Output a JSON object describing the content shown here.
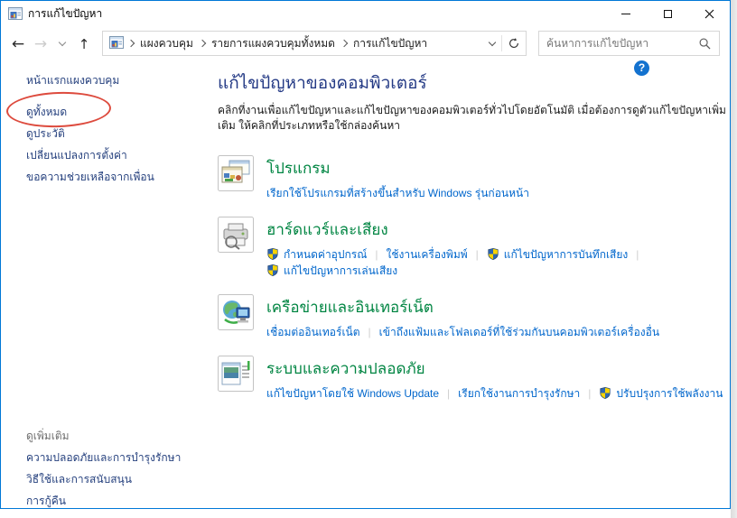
{
  "window": {
    "title": "การแก้ไขปัญหา"
  },
  "toolbar": {
    "breadcrumb": [
      "แผงควบคุม",
      "รายการแผงควบคุมทั้งหมด",
      "การแก้ไขปัญหา"
    ],
    "search_placeholder": "ค้นหาการแก้ไขปัญหา"
  },
  "help": {
    "glyph": "?"
  },
  "sidebar": {
    "items": [
      "หน้าแรกแผงควบคุม",
      "ดูทั้งหมด",
      "ดูประวัติ",
      "เปลี่ยนแปลงการตั้งค่า",
      "ขอความช่วยเหลือจากเพื่อน"
    ],
    "circled_item": "ดูทั้งหมด",
    "see_also_header": "ดูเพิ่มเติม",
    "see_also_items": [
      "ความปลอดภัยและการบำรุงรักษา",
      "วิธีใช้และการสนับสนุน",
      "การกู้คืน"
    ]
  },
  "main": {
    "heading": "แก้ไขปัญหาของคอมพิวเตอร์",
    "description": "คลิกที่งานเพื่อแก้ไขปัญหาและแก้ไขปัญหาของคอมพิวเตอร์ทั่วไปโดยอัตโนมัติ เมื่อต้องการดูตัวแก้ไขปัญหาเพิ่มเติม ให้คลิกที่ประเภทหรือใช้กล่องค้นหา",
    "sections": [
      {
        "title": "โปรแกรม",
        "icon": "programs-icon",
        "links": [
          {
            "label": "เรียกใช้โปรแกรมที่สร้างขึ้นสำหรับ Windows รุ่นก่อนหน้า",
            "shield": false
          }
        ]
      },
      {
        "title": "ฮาร์ดแวร์และเสียง",
        "icon": "hardware-sound-icon",
        "links": [
          {
            "label": "กำหนดค่าอุปกรณ์",
            "shield": true
          },
          {
            "label": "ใช้งานเครื่องพิมพ์",
            "shield": false
          },
          {
            "label": "แก้ไขปัญหาการบันทึกเสียง",
            "shield": true
          },
          {
            "label": "แก้ไขปัญหาการเล่นเสียง",
            "shield": true
          }
        ]
      },
      {
        "title": "เครือข่ายและอินเทอร์เน็ต",
        "icon": "network-internet-icon",
        "links": [
          {
            "label": "เชื่อมต่ออินเทอร์เน็ต",
            "shield": false
          },
          {
            "label": "เข้าถึงแฟ้มและโฟลเดอร์ที่ใช้ร่วมกันบนคอมพิวเตอร์เครื่องอื่น",
            "shield": false
          }
        ]
      },
      {
        "title": "ระบบและความปลอดภัย",
        "icon": "system-security-icon",
        "links": [
          {
            "label": "แก้ไขปัญหาโดยใช้ Windows Update",
            "shield": false
          },
          {
            "label": "เรียกใช้งานการบำรุงรักษา",
            "shield": false
          },
          {
            "label": "ปรับปรุงการใช้พลังงาน",
            "shield": true
          }
        ]
      }
    ]
  },
  "colors": {
    "window_border": "#0078D7",
    "category_title_green": "#008542",
    "task_link_blue": "#0066CC",
    "sidebar_link_blue": "#26417E",
    "annotation_red": "#DD4B3E",
    "help_badge_blue": "#1372CF"
  }
}
